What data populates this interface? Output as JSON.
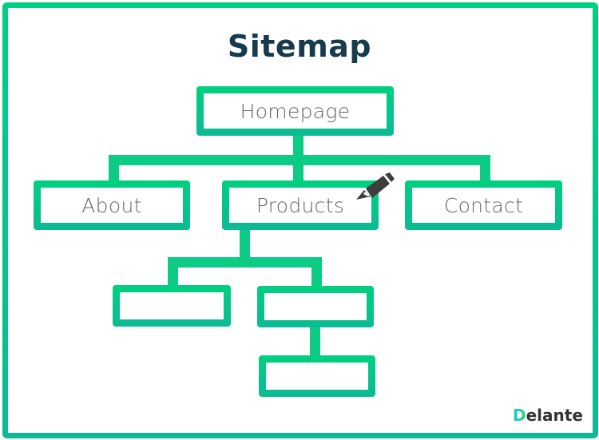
{
  "title": "Sitemap",
  "nodes": {
    "homepage": "Homepage",
    "about": "About",
    "products": "Products",
    "contact": "Contact",
    "product_child_1": "",
    "product_child_2": "",
    "product_grandchild": ""
  },
  "icons": {
    "edit": "pencil-icon"
  },
  "logo": {
    "first_letter": "D",
    "rest": "elante"
  },
  "colors": {
    "green": "#00d07f",
    "teal": "#0cba94",
    "title": "#163a4e",
    "node_text": "#666666"
  }
}
